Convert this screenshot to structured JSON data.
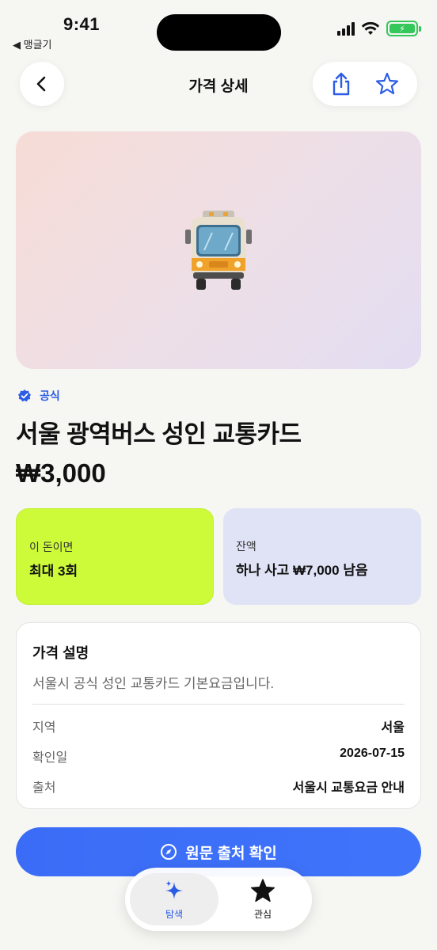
{
  "status": {
    "time": "9:41",
    "back_app": "◀ 맹글기"
  },
  "header": {
    "title": "가격 상세"
  },
  "hero": {
    "emoji": "🚍"
  },
  "product": {
    "badge": "공식",
    "title": "서울 광역버스 성인 교통카드",
    "price": "₩3,000"
  },
  "cards": [
    {
      "label": "이 돈이면",
      "value": "최대 3회"
    },
    {
      "label": "잔액",
      "value": "하나 사고 ₩7,000 남음"
    }
  ],
  "description": {
    "title": "가격 설명",
    "text": "서울시 공식 성인 교통카드 기본요금입니다.",
    "rows": [
      {
        "key": "지역",
        "value": "서울"
      },
      {
        "key": "확인일",
        "value": "2026-07-15"
      },
      {
        "key": "출처",
        "value": "서울시 교통요금 안내"
      }
    ]
  },
  "cta": {
    "label": "원문 출처 확인"
  },
  "tabbar": {
    "tabs": [
      {
        "label": "탐색"
      },
      {
        "label": "관심"
      }
    ]
  },
  "colors": {
    "accent": "#2b5ce6",
    "green_card": "#cdfb3a",
    "blue_card": "#dfe3f5",
    "cta": "#3b6cf7"
  }
}
